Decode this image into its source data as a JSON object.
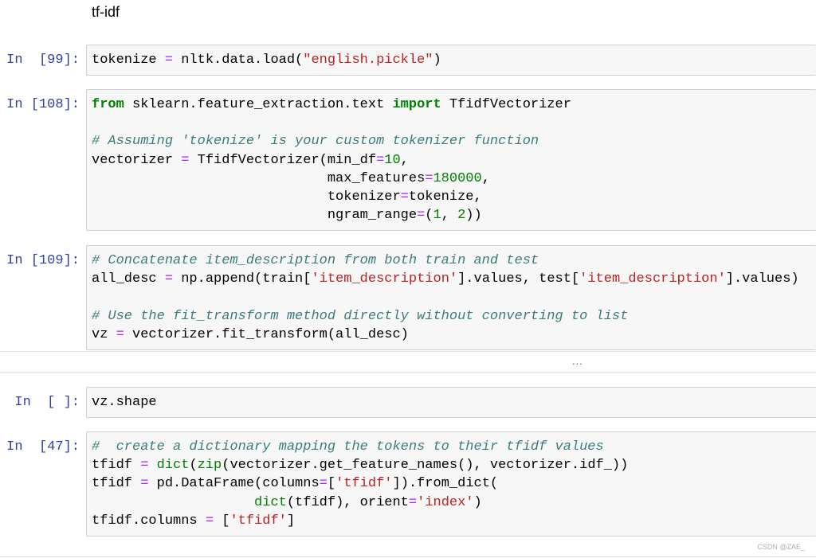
{
  "markdown": {
    "heading": "tf-idf"
  },
  "cells": [
    {
      "prompt": "In  [99]:",
      "lines": [
        [
          [
            "",
            "tokenize "
          ],
          [
            "op",
            "="
          ],
          [
            "",
            " nltk.data.load("
          ],
          [
            "str",
            "\"english.pickle\""
          ],
          [
            "",
            ")"
          ]
        ]
      ]
    },
    {
      "prompt": "In [108]:",
      "lines": [
        [
          [
            "kw",
            "from"
          ],
          [
            "",
            " sklearn.feature_extraction.text "
          ],
          [
            "kw",
            "import"
          ],
          [
            "",
            " TfidfVectorizer"
          ]
        ],
        [],
        [
          [
            "cm",
            "# Assuming 'tokenize' is your custom tokenizer function"
          ]
        ],
        [
          [
            "",
            "vectorizer "
          ],
          [
            "op",
            "="
          ],
          [
            "",
            " TfidfVectorizer(min_df"
          ],
          [
            "op",
            "="
          ],
          [
            "num",
            "10"
          ],
          [
            "",
            ","
          ]
        ],
        [
          [
            "",
            "                             max_features"
          ],
          [
            "op",
            "="
          ],
          [
            "num",
            "180000"
          ],
          [
            "",
            ","
          ]
        ],
        [
          [
            "",
            "                             tokenizer"
          ],
          [
            "op",
            "="
          ],
          [
            "",
            "tokenize,"
          ]
        ],
        [
          [
            "",
            "                             ngram_range"
          ],
          [
            "op",
            "="
          ],
          [
            "",
            "("
          ],
          [
            "num",
            "1"
          ],
          [
            "",
            ", "
          ],
          [
            "num",
            "2"
          ],
          [
            "",
            "))"
          ]
        ]
      ]
    },
    {
      "prompt": "In [109]:",
      "lines": [
        [
          [
            "cm",
            "# Concatenate item_description from both train and test"
          ]
        ],
        [
          [
            "",
            "all_desc "
          ],
          [
            "op",
            "="
          ],
          [
            "",
            " np.append(train["
          ],
          [
            "str",
            "'item_description'"
          ],
          [
            "",
            "].values, test["
          ],
          [
            "str",
            "'item_description'"
          ],
          [
            "",
            "].values)"
          ]
        ],
        [],
        [
          [
            "cm",
            "# Use the fit_transform method directly without converting to list"
          ]
        ],
        [
          [
            "",
            "vz "
          ],
          [
            "op",
            "="
          ],
          [
            "",
            " vectorizer.fit_transform(all_desc)"
          ]
        ]
      ]
    },
    {
      "prompt": "In  [ ]:",
      "lines": [
        [
          [
            "",
            "vz.shape"
          ]
        ]
      ]
    },
    {
      "prompt": "In  [47]:",
      "lines": [
        [
          [
            "cm",
            "#  create a dictionary mapping the tokens to their tfidf values"
          ]
        ],
        [
          [
            "",
            "tfidf "
          ],
          [
            "op",
            "="
          ],
          [
            "",
            " "
          ],
          [
            "num",
            "dict"
          ],
          [
            "",
            "("
          ],
          [
            "num",
            "zip"
          ],
          [
            "",
            "(vectorizer.get_feature_names(), vectorizer.idf_))"
          ]
        ],
        [
          [
            "",
            "tfidf "
          ],
          [
            "op",
            "="
          ],
          [
            "",
            " pd.DataFrame(columns"
          ],
          [
            "op",
            "="
          ],
          [
            "",
            "["
          ],
          [
            "str",
            "'tfidf'"
          ],
          [
            "",
            "]).from_dict("
          ]
        ],
        [
          [
            "",
            "                    "
          ],
          [
            "num",
            "dict"
          ],
          [
            "",
            "(tfidf), orient"
          ],
          [
            "op",
            "="
          ],
          [
            "str",
            "'index'"
          ],
          [
            "",
            ")"
          ]
        ],
        [
          [
            "",
            "tfidf.columns "
          ],
          [
            "op",
            "="
          ],
          [
            "",
            " ["
          ],
          [
            "str",
            "'tfidf'"
          ],
          [
            "",
            "]"
          ]
        ]
      ]
    }
  ],
  "output_collapsed": "...",
  "watermark": "CSDN @ZAE_"
}
